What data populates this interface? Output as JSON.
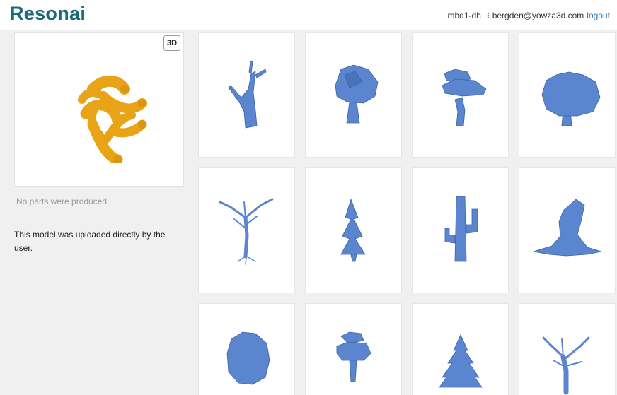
{
  "header": {
    "logo_text": "Resonai",
    "server": "mbd1-dh",
    "menu_icon": "kebab-icon",
    "email": "bergden@yowza3d.com",
    "logout_label": "logout"
  },
  "preview": {
    "view_3d_label": "3D",
    "model_color": "#e8a317"
  },
  "sidebar": {
    "no_parts_text": "No parts were produced",
    "upload_note": "This model was uploaded directly by the user."
  },
  "results": {
    "model_color": "#5b86cf",
    "items": [
      {
        "name": "dead-trunk"
      },
      {
        "name": "lowpoly-leafy-tree"
      },
      {
        "name": "stacked-tree"
      },
      {
        "name": "bushy-tree"
      },
      {
        "name": "bare-branching-tree"
      },
      {
        "name": "pine-tree"
      },
      {
        "name": "cactus"
      },
      {
        "name": "twisted-stump"
      },
      {
        "name": "round-crown-tree"
      },
      {
        "name": "stacked-rock-tree"
      },
      {
        "name": "spiky-pine"
      },
      {
        "name": "gnarled-tree"
      }
    ]
  }
}
